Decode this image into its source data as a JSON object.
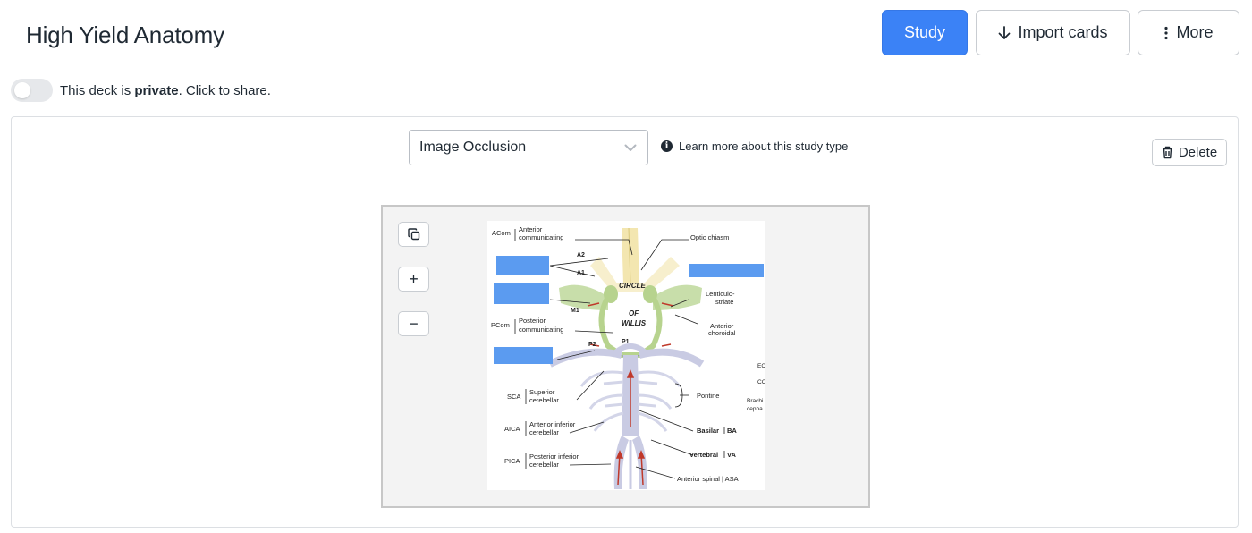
{
  "header": {
    "title": "High Yield Anatomy",
    "study_label": "Study",
    "import_label": "Import cards",
    "more_label": "More"
  },
  "privacy": {
    "prefix": "This deck is ",
    "status": "private",
    "suffix": ". Click to share."
  },
  "editor": {
    "study_type": "Image Occlusion",
    "learn_more": "Learn more about this study type",
    "delete_label": "Delete",
    "tools": {
      "copy_icon": "copy-icon",
      "zoom_in": "+",
      "zoom_out": "−"
    }
  },
  "diagram": {
    "labels": {
      "acom_abbr": "ACom",
      "acom_name1": "Anterior",
      "acom_name2": "communicating",
      "optic": "Optic chiasm",
      "a2": "A2",
      "a1": "A1",
      "circle": "CIRCLE",
      "of": "OF",
      "willis": "WILLIS",
      "m1": "M1",
      "lenticulo1": "Lenticulo-",
      "lenticulo2": "striate",
      "ant_chor1": "Anterior",
      "ant_chor2": "choroidal",
      "pcom_abbr": "PCom",
      "pcom_name1": "Posterior",
      "pcom_name2": "communicating",
      "p2": "P2",
      "p1": "P1",
      "eca": "EC",
      "cca": "CC",
      "brachio1": "Brachi",
      "brachio2": "cepha",
      "sca_abbr": "SCA",
      "sca_name1": "Superior",
      "sca_name2": "cerebellar",
      "pontine": "Pontine",
      "aica_abbr": "AICA",
      "aica_name1": "Anterior inferior",
      "aica_name2": "cerebellar",
      "basilar": "Basilar",
      "ba": "BA",
      "vertebral": "Vertebral",
      "va": "VA",
      "pica_abbr": "PICA",
      "pica_name1": "Posterior inferior",
      "pica_name2": "cerebellar",
      "asa": "Anterior spinal | ASA"
    }
  },
  "colors": {
    "accent": "#3b82f6",
    "mask": "#5b9bf0",
    "artery": "#c9cbe3",
    "mca": "#c8deaa",
    "optic": "#f3e6b0",
    "flow": "#c0392b"
  }
}
